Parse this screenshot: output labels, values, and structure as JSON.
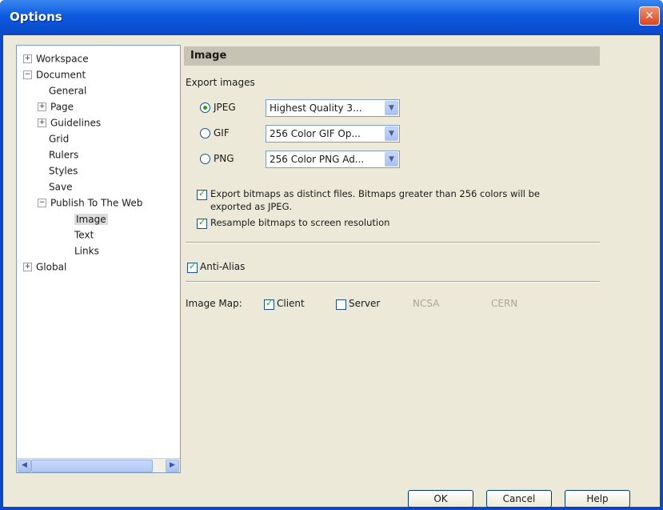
{
  "window": {
    "title": "Options",
    "close_glyph": "✕"
  },
  "tree": {
    "items": [
      {
        "label": "Workspace",
        "exp": "+"
      },
      {
        "label": "Document",
        "exp": "−"
      },
      {
        "label": "General",
        "exp": ""
      },
      {
        "label": "Page",
        "exp": "+"
      },
      {
        "label": "Guidelines",
        "exp": "+"
      },
      {
        "label": "Grid",
        "exp": ""
      },
      {
        "label": "Rulers",
        "exp": ""
      },
      {
        "label": "Styles",
        "exp": ""
      },
      {
        "label": "Save",
        "exp": ""
      },
      {
        "label": "Publish To The Web",
        "exp": "−"
      },
      {
        "label": "Image",
        "exp": ""
      },
      {
        "label": "Text",
        "exp": ""
      },
      {
        "label": "Links",
        "exp": ""
      },
      {
        "label": "Global",
        "exp": "+"
      }
    ],
    "selected": "Image"
  },
  "panel": {
    "header": "Image",
    "export_images_label": "Export images",
    "formats": [
      {
        "label": "JPEG",
        "value": "Highest Quality 3...",
        "selected": true
      },
      {
        "label": "GIF",
        "value": "256 Color GIF Op...",
        "selected": false
      },
      {
        "label": "PNG",
        "value": "256 Color PNG Ad...",
        "selected": false
      }
    ],
    "export_bitmaps_line1": "Export bitmaps as distinct files. Bitmaps greater than 256 colors will be",
    "export_bitmaps_line2": "exported as JPEG.",
    "resample_label": "Resample bitmaps to screen resolution",
    "anti_alias_label": "Anti-Alias",
    "image_map_label": "Image Map:",
    "client_label": "Client",
    "server_label": "Server",
    "ncsa_label": "NCSA",
    "cern_label": "CERN"
  },
  "buttons": {
    "ok": "OK",
    "cancel": "Cancel",
    "help": "Help"
  },
  "icons": {
    "scroll_left": "◀",
    "scroll_right": "▶",
    "dropdown": "▼"
  }
}
